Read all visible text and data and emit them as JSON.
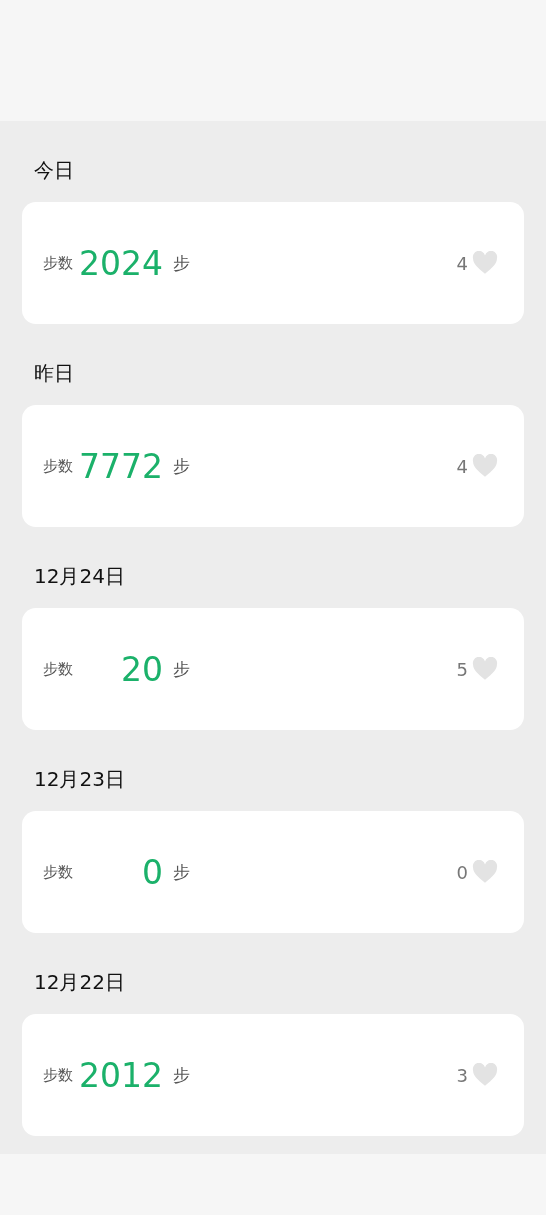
{
  "days": [
    {
      "date": "今日",
      "steps_label": "步数",
      "steps": "2024",
      "unit": "步",
      "likes": "4"
    },
    {
      "date": "昨日",
      "steps_label": "步数",
      "steps": "7772",
      "unit": "步",
      "likes": "4"
    },
    {
      "date": "12月24日",
      "steps_label": "步数",
      "steps": "20",
      "unit": "步",
      "likes": "5"
    },
    {
      "date": "12月23日",
      "steps_label": "步数",
      "steps": "0",
      "unit": "步",
      "likes": "0"
    },
    {
      "date": "12月22日",
      "steps_label": "步数",
      "steps": "2012",
      "unit": "步",
      "likes": "3"
    }
  ]
}
